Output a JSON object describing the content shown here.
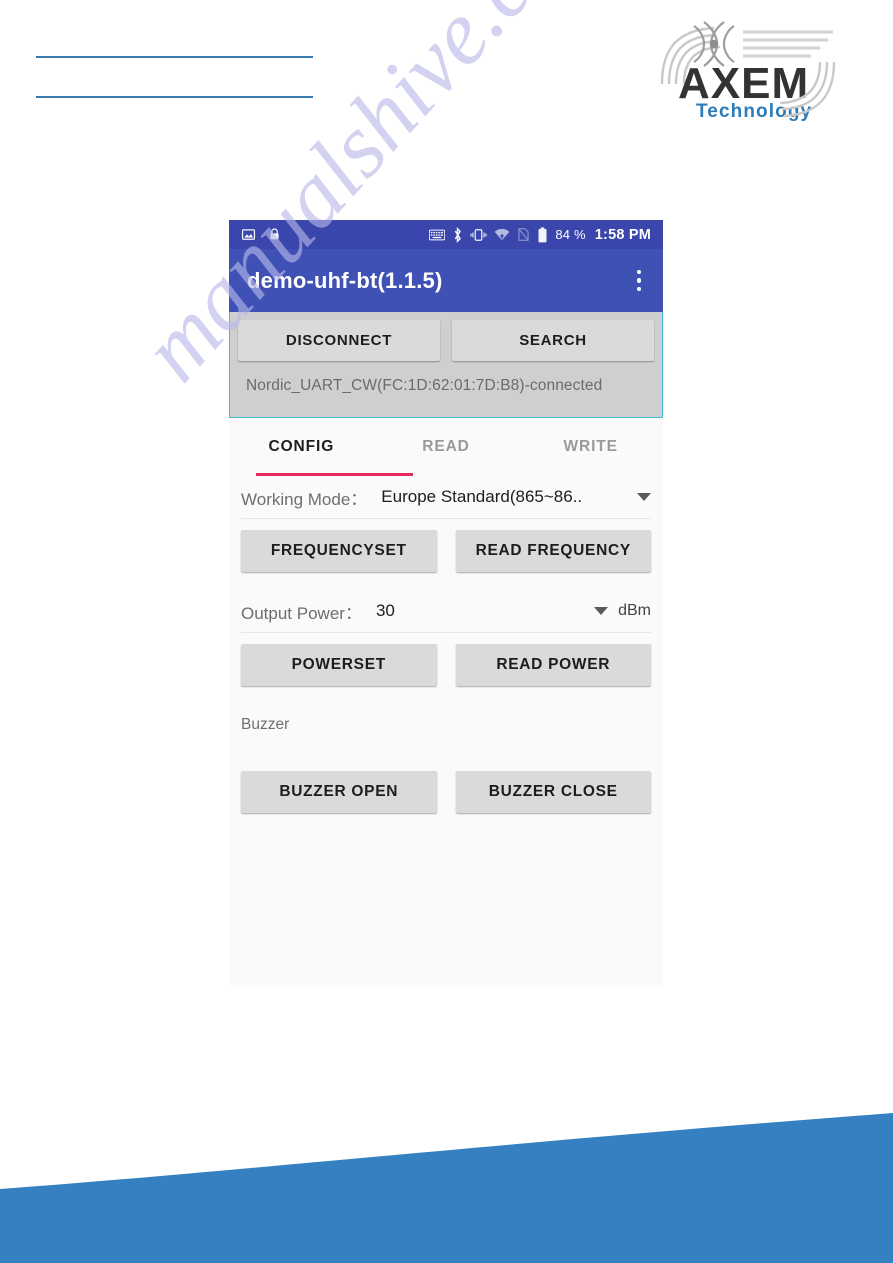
{
  "document": {
    "watermark": "manualshive.com",
    "logo": {
      "name": "AXEM",
      "tagline": "Technology"
    },
    "accent_blue": "#3a78ad",
    "wave_blue": "#3480c0"
  },
  "screenshot": {
    "statusbar": {
      "icons_left": [
        "image-icon",
        "lock-icon"
      ],
      "icons_right": [
        "keyboard-icon",
        "bluetooth-icon",
        "vibrate-icon",
        "wifi-icon",
        "no-sim-icon",
        "battery-icon"
      ],
      "battery": "84 %",
      "time": "1:58 PM",
      "background": "#3a46ac"
    },
    "appbar": {
      "title": "demo-uhf-bt(1.1.5)",
      "overflow_icon": "more-vert-icon",
      "background": "#3f51b5"
    },
    "connection": {
      "disconnect_label": "DISCONNECT",
      "search_label": "SEARCH",
      "status": "Nordic_UART_CW(FC:1D:62:01:7D:B8)-connected"
    },
    "tabs": [
      {
        "label": "CONFIG",
        "active": true
      },
      {
        "label": "READ",
        "active": false
      },
      {
        "label": "WRITE",
        "active": false
      }
    ],
    "tab_indicator_color": "#e8285e",
    "config": {
      "working_mode": {
        "label": "Working Mode：",
        "value": "Europe Standard(865~86..",
        "dropdown_icon": "chevron-down-icon"
      },
      "frequency_set_label": "FREQUENCYSET",
      "read_frequency_label": "READ FREQUENCY",
      "output_power": {
        "label": "Output Power：",
        "value": "30",
        "unit": "dBm",
        "dropdown_icon": "chevron-down-icon"
      },
      "power_set_label": "POWERSET",
      "read_power_label": "READ POWER",
      "buzzer_section_label": "Buzzer",
      "buzzer_open_label": "BUZZER OPEN",
      "buzzer_close_label": "BUZZER CLOSE"
    }
  }
}
